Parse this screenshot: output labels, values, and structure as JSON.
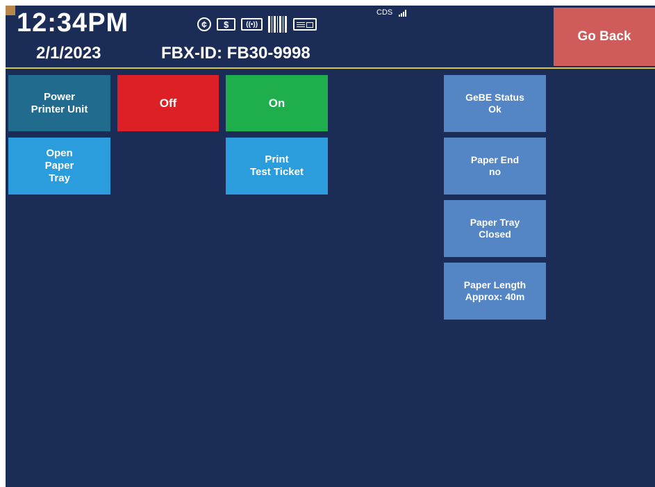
{
  "header": {
    "time": "12:34PM",
    "date": "2/1/2023",
    "fbx_id": "FBX-ID: FB30-9998",
    "cds_label": "CDS",
    "icons": [
      "coin-icon",
      "dollar-bill-icon",
      "wireless-icon",
      "barcode-icon",
      "ticket-icon",
      "signal-icon"
    ],
    "icon_glyphs": {
      "coin": "¢",
      "dollar": "$",
      "wireless": "((•))"
    }
  },
  "buttons": {
    "go_back": "Go Back",
    "power_printer_unit": "Power\nPrinter Unit",
    "off": "Off",
    "on": "On",
    "open_paper_tray": "Open\nPaper\nTray",
    "print_test_ticket": "Print\nTest Ticket"
  },
  "status": [
    "GeBE Status\nOk",
    "Paper End\nno",
    "Paper Tray\nClosed",
    "Paper Length\nApprox: 40m"
  ],
  "colors": {
    "background": "#1b2d57",
    "divider": "#d8c93a",
    "go_back": "#cf5b5b",
    "off": "#dc2025",
    "on": "#1fae4c",
    "action": "#2b9ddc",
    "power_label": "#216b8e",
    "status_tile": "#5485c4"
  }
}
